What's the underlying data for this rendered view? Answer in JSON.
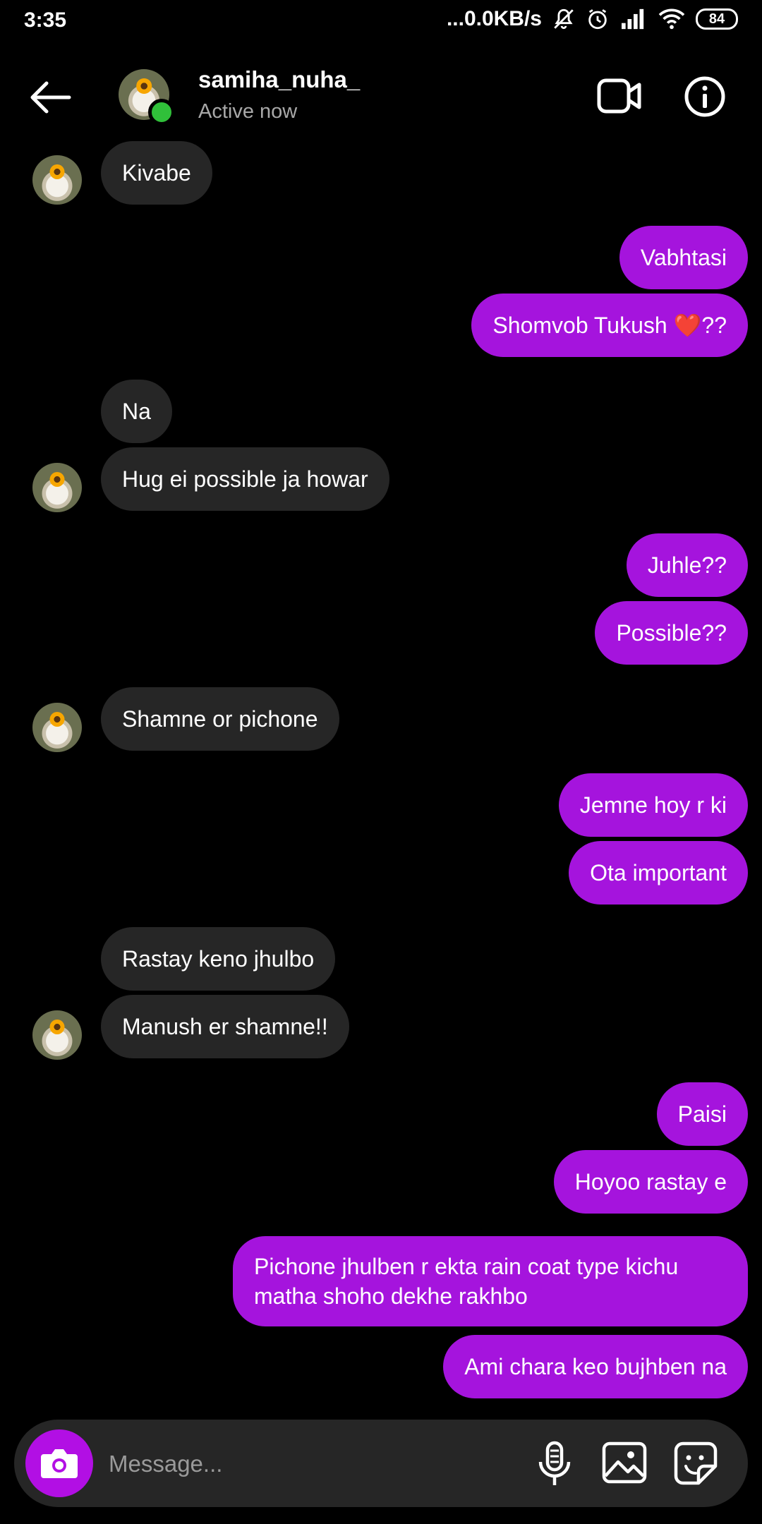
{
  "status_bar": {
    "time": "3:35",
    "network_speed": "...0.0KB/s",
    "battery": "84",
    "icons": [
      "mute-icon",
      "alarm-icon",
      "signal-icon",
      "wifi-icon",
      "battery-icon"
    ]
  },
  "header": {
    "name": "samiha_nuha_",
    "status": "Active now"
  },
  "messages": [
    {
      "sender": "them",
      "text": "Kivabe"
    },
    {
      "sender": "me",
      "text": "Vabhtasi"
    },
    {
      "sender": "me",
      "text": "Shomvob Tukush ❤️??"
    },
    {
      "sender": "them",
      "text": "Na"
    },
    {
      "sender": "them",
      "text": "Hug ei possible ja howar"
    },
    {
      "sender": "me",
      "text": "Juhle??"
    },
    {
      "sender": "me",
      "text": "Possible??"
    },
    {
      "sender": "them",
      "text": "Shamne or pichone"
    },
    {
      "sender": "me",
      "text": "Jemne hoy r ki"
    },
    {
      "sender": "me",
      "text": "Ota important"
    },
    {
      "sender": "them",
      "text": "Rastay keno jhulbo"
    },
    {
      "sender": "them",
      "text": "Manush er shamne!!"
    },
    {
      "sender": "me",
      "text": "Paisi"
    },
    {
      "sender": "me",
      "text": "Hoyoo rastay e"
    },
    {
      "sender": "me",
      "text": "Pichone jhulben r ekta rain coat type kichu matha shoho dekhe rakhbo"
    },
    {
      "sender": "me",
      "text": "Ami chara keo bujhben na"
    }
  ],
  "composer": {
    "placeholder": "Message..."
  },
  "colors": {
    "background": "#000000",
    "outgoing_bubble": "#a514dd",
    "incoming_bubble": "#262626",
    "online_dot": "#30c03a",
    "camera_button": "#b20fe4"
  }
}
